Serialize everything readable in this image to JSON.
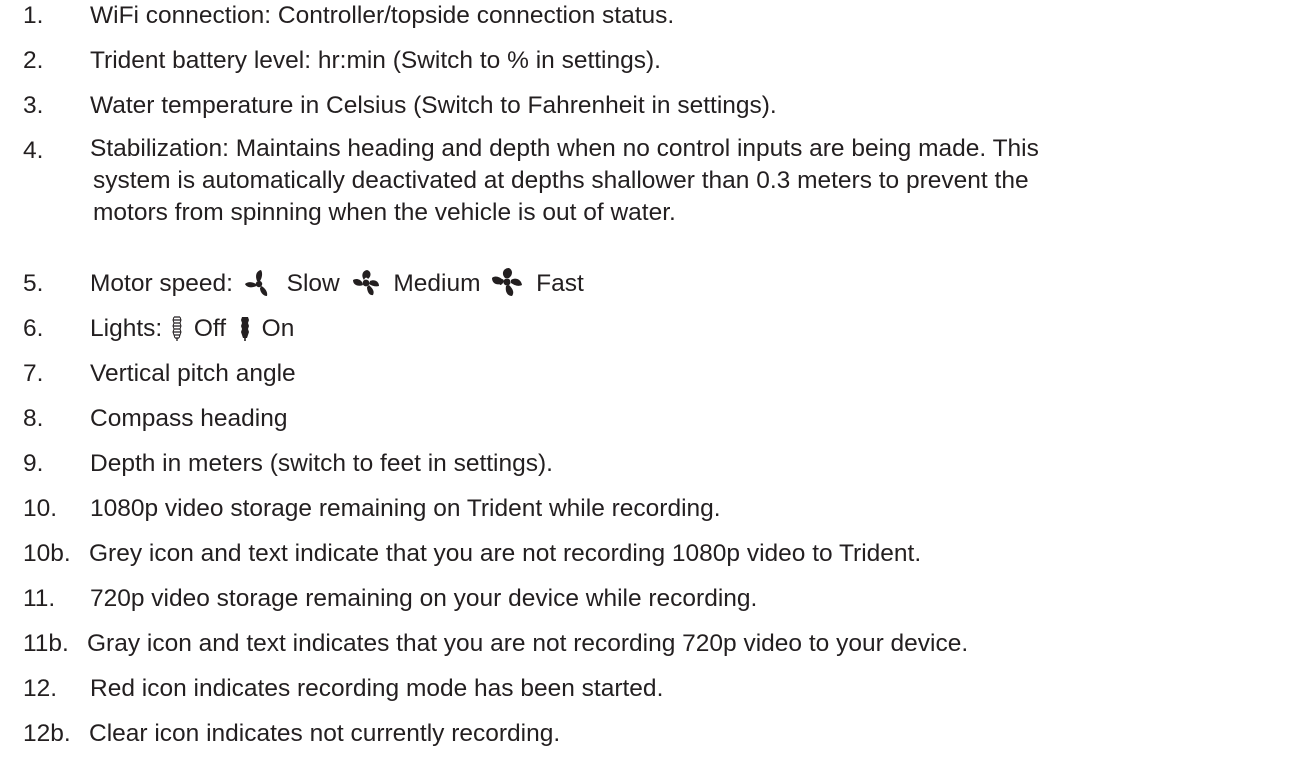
{
  "items": [
    {
      "num": "1.",
      "text": "WiFi connection: Controller/topside connection status."
    },
    {
      "num": "2.",
      "text": "Trident battery level: hr:min (Switch to % in settings)."
    },
    {
      "num": "3.",
      "text": "Water temperature in Celsius (Switch to Fahrenheit in settings)."
    },
    {
      "num": "4.",
      "lines": [
        "Stabilization: Maintains heading and depth when no control inputs are being made. This",
        "system is automatically deactivated at depths shallower than 0.3 meters to prevent the",
        "motors from spinning when the vehicle is out of water."
      ]
    },
    {
      "num": "5.",
      "label": "Motor speed:",
      "slow": "Slow",
      "medium": "Medium",
      "fast": "Fast"
    },
    {
      "num": "6.",
      "label": "Lights:",
      "off": "Off",
      "on": "On"
    },
    {
      "num": "7.",
      "text": "Vertical pitch angle"
    },
    {
      "num": "8.",
      "text": "Compass heading"
    },
    {
      "num": "9.",
      "text": "Depth in meters (switch to feet in settings)."
    },
    {
      "num": "10.",
      "text": "1080p video storage remaining on Trident while recording."
    },
    {
      "num": "10b.",
      "text": "Grey icon and text indicate that you are not recording 1080p video to Trident."
    },
    {
      "num": "11.",
      "text": "720p video storage remaining on your device while recording."
    },
    {
      "num": "11b.",
      "text": "Gray icon and text indicates that you are not recording 720p video to your device."
    },
    {
      "num": "12.",
      "text": "Red icon indicates recording mode has been started."
    },
    {
      "num": "12b.",
      "text": "Clear icon indicates not currently recording."
    }
  ],
  "icons": {
    "slow": "fan-slow-icon",
    "medium": "fan-medium-icon",
    "fast": "fan-fast-icon",
    "light_off": "light-off-icon",
    "light_on": "light-on-icon"
  },
  "colors": {
    "text": "#231f20"
  }
}
